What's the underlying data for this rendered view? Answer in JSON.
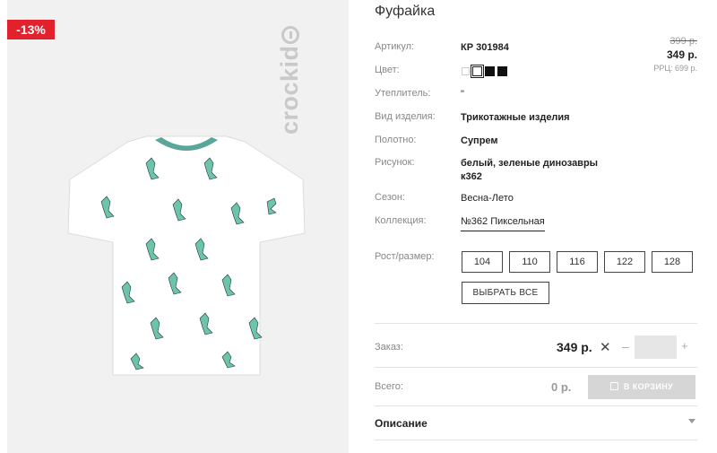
{
  "product": {
    "title": "Фуфайка",
    "discount_badge": "-13%",
    "brand_logo_text": "crockid",
    "price_old": "399 р.",
    "price_new": "349 р.",
    "price_rrc": "РРЦ: 699 р."
  },
  "attributes": {
    "article_label": "Артикул:",
    "article_value": "КР 301984",
    "color_label": "Цвет:",
    "insulation_label": "Утеплитель:",
    "insulation_value": "\"",
    "type_label": "Вид изделия:",
    "type_value": "Трикотажные изделия",
    "fabric_label": "Полотно:",
    "fabric_value": "Супрем",
    "pattern_label": "Рисунок:",
    "pattern_value_line1": "белый, зеленые динозавры",
    "pattern_value_line2": "к362",
    "season_label": "Сезон:",
    "season_value": "Весна-Лето",
    "collection_label": "Коллекция:",
    "collection_value": "№362 Пиксельная"
  },
  "colors": [
    "#ffffff",
    "#ffffff",
    "#111111",
    "#111111"
  ],
  "sizes": {
    "label": "Рост/размер:",
    "options": [
      "104",
      "110",
      "116",
      "122",
      "128"
    ],
    "select_all": "ВЫБРАТЬ ВСЕ"
  },
  "order": {
    "label": "Заказ:",
    "price": "349 р.",
    "times": "✕",
    "minus": "–",
    "plus": "+",
    "quantity": ""
  },
  "total": {
    "label": "Всего:",
    "value": "0 р.",
    "cart_button": "В КОРЗИНУ"
  },
  "description": {
    "label": "Описание"
  }
}
